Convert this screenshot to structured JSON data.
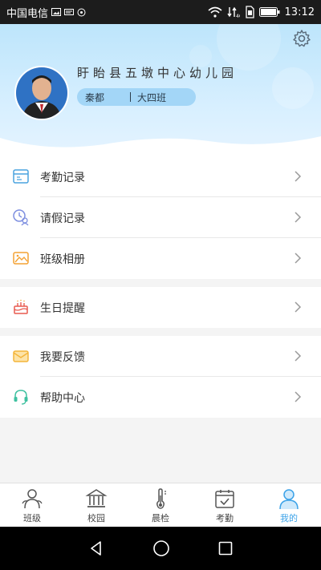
{
  "status": {
    "carrier": "中国电信",
    "time": "13:12"
  },
  "profile": {
    "school": "盱眙县五墩中心幼儿园",
    "name": "秦都",
    "class": "大四班"
  },
  "menu": {
    "group1": [
      {
        "label": "考勤记录",
        "icon": "attendance-record-icon",
        "color": "#4aa3df"
      },
      {
        "label": "请假记录",
        "icon": "leave-record-icon",
        "color": "#7e8fe0"
      },
      {
        "label": "班级相册",
        "icon": "photo-album-icon",
        "color": "#f4a233"
      }
    ],
    "group2": [
      {
        "label": "生日提醒",
        "icon": "birthday-cake-icon",
        "color": "#e85a4f"
      }
    ],
    "group3": [
      {
        "label": "我要反馈",
        "icon": "feedback-mail-icon",
        "color": "#f4b53a"
      },
      {
        "label": "帮助中心",
        "icon": "help-headset-icon",
        "color": "#3ec1a0"
      }
    ]
  },
  "tabs": [
    {
      "label": "班级",
      "icon": "class-icon"
    },
    {
      "label": "校园",
      "icon": "campus-icon"
    },
    {
      "label": "晨检",
      "icon": "thermometer-icon"
    },
    {
      "label": "考勤",
      "icon": "calendar-check-icon"
    },
    {
      "label": "我的",
      "icon": "user-profile-icon",
      "active": true
    }
  ],
  "colors": {
    "accent": "#3ba2e8",
    "header": "#bde5fb"
  }
}
